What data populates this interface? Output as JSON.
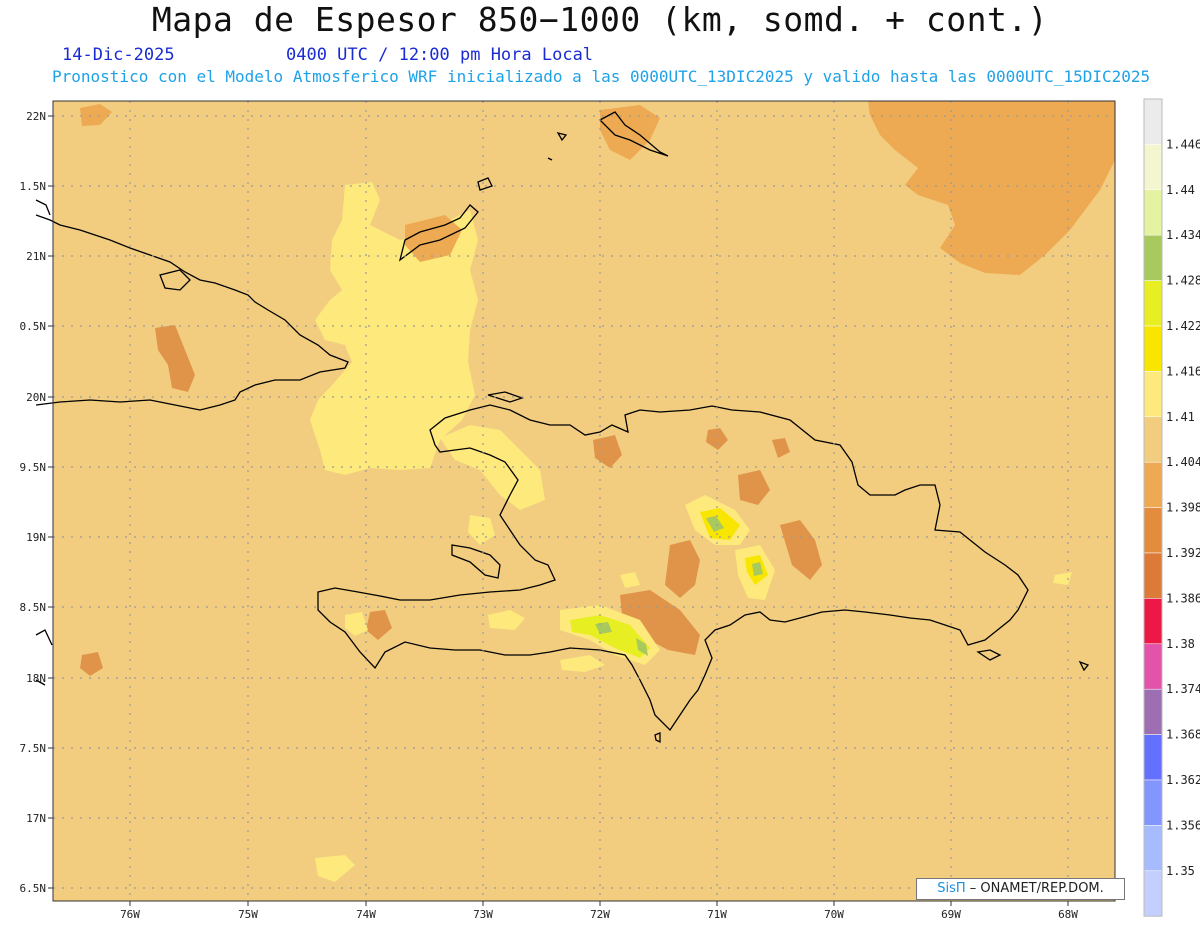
{
  "header": {
    "title": "Mapa de Espesor 850−1000 (km, somd. + cont.)",
    "date": "14-Dic-2025",
    "time": "0400 UTC / 12:00 pm Hora Local",
    "model_line": "Pronostico con el Modelo Atmosferico WRF inicializado a las 0000UTC_13DIC2025 y valido hasta las  0000UTC_15DIC2025"
  },
  "map": {
    "lat_labels": [
      "22N",
      "1.5N",
      "21N",
      "0.5N",
      "20N",
      "9.5N",
      "19N",
      "8.5N",
      "18N",
      "7.5N",
      "17N",
      "6.5N"
    ],
    "lon_labels": [
      "76W",
      "75W",
      "74W",
      "73W",
      "72W",
      "71W",
      "70W",
      "69W",
      "68W"
    ],
    "background_color": "#f2cd80",
    "coastline_color": "#000000"
  },
  "legend": {
    "levels": [
      "1.446",
      "1.44",
      "1.434",
      "1.428",
      "1.422",
      "1.416",
      "1.41",
      "1.404",
      "1.398",
      "1.392",
      "1.386",
      "1.38",
      "1.374",
      "1.368",
      "1.362",
      "1.356",
      "1.35"
    ],
    "colors": [
      "#ebebeb",
      "#f3f6cf",
      "#e4f3a0",
      "#a7c95e",
      "#e7ef22",
      "#f8e600",
      "#fde97c",
      "#f2cd80",
      "#edaa53",
      "#e48c3e",
      "#dc7a38",
      "#ec1845",
      "#e253a9",
      "#9d6fb2",
      "#6470ff",
      "#8395ff",
      "#a7bcff",
      "#c2cfff"
    ]
  },
  "credit": {
    "brand": "SisΠ",
    "text": " – ONAMET/REP.DOM."
  }
}
